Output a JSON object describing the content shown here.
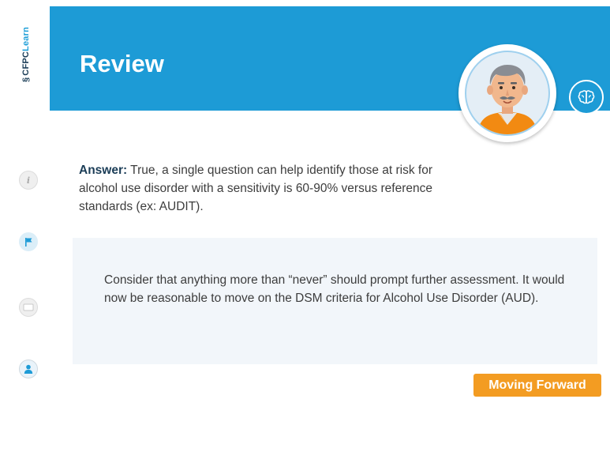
{
  "brand": {
    "mark": "§",
    "name_a": "CFPC",
    "name_b": "Learn"
  },
  "header": {
    "title": "Review"
  },
  "nav": [
    {
      "icon": "info-icon",
      "glyph": "i"
    },
    {
      "icon": "flag-icon"
    },
    {
      "icon": "book-icon"
    },
    {
      "icon": "user-icon"
    }
  ],
  "answer": {
    "label": "Answer:",
    "text": " True, a single question can help identify those at risk for alcohol use disorder with a sensitivity is 60-90% versus reference standards (ex: AUDIT)."
  },
  "panel": {
    "text": "Consider that anything more than “never” should prompt further assessment. It would now be reasonable to move on the DSM criteria for Alcohol Use Disorder (AUD)."
  },
  "next_button": {
    "label": "Moving Forward"
  },
  "colors": {
    "header_bg": "#1d9bd6",
    "accent_orange": "#f39c22",
    "panel_bg": "#f2f6fa",
    "brand_navy": "#1b3d57"
  }
}
